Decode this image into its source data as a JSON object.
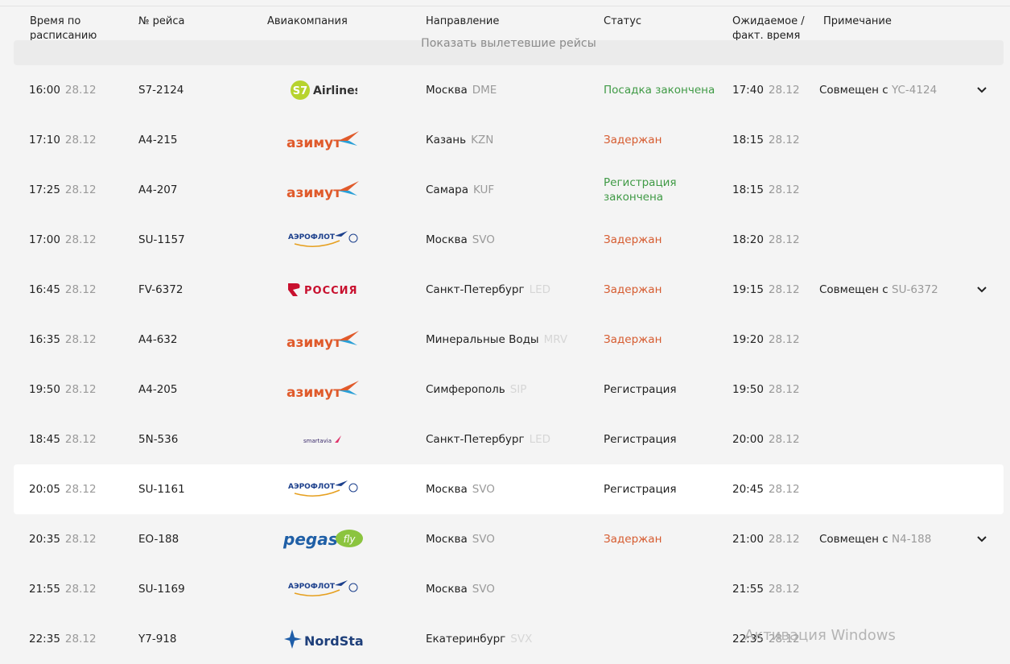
{
  "columns": {
    "sched": "Время по расписанию",
    "flight": "№ рейса",
    "airline": "Авиакомпания",
    "dest": "Направление",
    "status": "Статус",
    "est": "Ожидаемое / факт. время",
    "note": "Примечание"
  },
  "show_departed": "Показать вылетевшие рейсы",
  "rows": [
    {
      "time": "16:00",
      "date": "28.12",
      "flight": "S7-2124",
      "airline": "s7",
      "city": "Москва",
      "code": "DME",
      "status": "Посадка закончена",
      "status_type": "green",
      "est": "17:40",
      "est_date": "28.12",
      "note": "Совмещен с ",
      "note_code": "YC-4124",
      "chevron": true
    },
    {
      "time": "17:10",
      "date": "28.12",
      "flight": "A4-215",
      "airline": "azimut",
      "city": "Казань",
      "code": "KZN",
      "status": "Задержан",
      "status_type": "red",
      "est": "18:15",
      "est_date": "28.12",
      "note": "",
      "note_code": "",
      "chevron": false
    },
    {
      "time": "17:25",
      "date": "28.12",
      "flight": "A4-207",
      "airline": "azimut",
      "city": "Самара",
      "code": "KUF",
      "status": "Регистрация закончена",
      "status_type": "green",
      "est": "18:15",
      "est_date": "28.12",
      "note": "",
      "note_code": "",
      "chevron": false
    },
    {
      "time": "17:00",
      "date": "28.12",
      "flight": "SU-1157",
      "airline": "aeroflot",
      "city": "Москва",
      "code": "SVO",
      "status": "Задержан",
      "status_type": "red",
      "est": "18:20",
      "est_date": "28.12",
      "note": "",
      "note_code": "",
      "chevron": false
    },
    {
      "time": "16:45",
      "date": "28.12",
      "flight": "FV-6372",
      "airline": "rossiya",
      "city": "Санкт-Петербург",
      "code": "LED",
      "code_faint": true,
      "status": "Задержан",
      "status_type": "red",
      "est": "19:15",
      "est_date": "28.12",
      "note": "Совмещен с ",
      "note_code": "SU-6372",
      "chevron": true
    },
    {
      "time": "16:35",
      "date": "28.12",
      "flight": "A4-632",
      "airline": "azimut",
      "city": "Минеральные Воды",
      "code": "MRV",
      "code_faint": true,
      "status": "Задержан",
      "status_type": "red",
      "est": "19:20",
      "est_date": "28.12",
      "note": "",
      "note_code": "",
      "chevron": false
    },
    {
      "time": "19:50",
      "date": "28.12",
      "flight": "A4-205",
      "airline": "azimut",
      "city": "Симферополь",
      "code": "SIP",
      "code_faint": true,
      "status": "Регистрация",
      "status_type": "dark",
      "est": "19:50",
      "est_date": "28.12",
      "note": "",
      "note_code": "",
      "chevron": false
    },
    {
      "time": "18:45",
      "date": "28.12",
      "flight": "5N-536",
      "airline": "smartavia",
      "city": "Санкт-Петербург",
      "code": "LED",
      "code_faint": true,
      "status": "Регистрация",
      "status_type": "dark",
      "est": "20:00",
      "est_date": "28.12",
      "note": "",
      "note_code": "",
      "chevron": false
    },
    {
      "time": "20:05",
      "date": "28.12",
      "flight": "SU-1161",
      "airline": "aeroflot",
      "city": "Москва",
      "code": "SVO",
      "status": "Регистрация",
      "status_type": "dark",
      "est": "20:45",
      "est_date": "28.12",
      "note": "",
      "note_code": "",
      "chevron": false,
      "highlight": true
    },
    {
      "time": "20:35",
      "date": "28.12",
      "flight": "EO-188",
      "airline": "pegas",
      "city": "Москва",
      "code": "SVO",
      "status": "Задержан",
      "status_type": "red",
      "est": "21:00",
      "est_date": "28.12",
      "note": "Совмещен с ",
      "note_code": "N4-188",
      "chevron": true
    },
    {
      "time": "21:55",
      "date": "28.12",
      "flight": "SU-1169",
      "airline": "aeroflot",
      "city": "Москва",
      "code": "SVO",
      "status": "",
      "status_type": "dark",
      "est": "21:55",
      "est_date": "28.12",
      "note": "",
      "note_code": "",
      "chevron": false
    },
    {
      "time": "22:35",
      "date": "28.12",
      "flight": "Y7-918",
      "airline": "nordstar",
      "city": "Екатеринбург",
      "code": "SVX",
      "code_faint": true,
      "status": "",
      "status_type": "dark",
      "est": "22:35",
      "est_date": "28.12",
      "note": "",
      "note_code": "",
      "chevron": false
    }
  ],
  "logos": {
    "s7": "S7 Airlines",
    "azimut": "азимут",
    "aeroflot": "АЭРОФЛОТ",
    "rossiya": "РОССИЯ",
    "smartavia": "smartavia",
    "pegas": "pegas fly",
    "nordstar": "NordStar"
  },
  "watermark": "Активация Windows",
  "colors": {
    "green": "#3f9a45",
    "red": "#d65b2f",
    "s7": "#b7d32e",
    "azimut": "#e05a2b",
    "aeroflot": "#1b3f8c",
    "rossiya": "#c8102e",
    "pegas": "#1f5fa6"
  }
}
